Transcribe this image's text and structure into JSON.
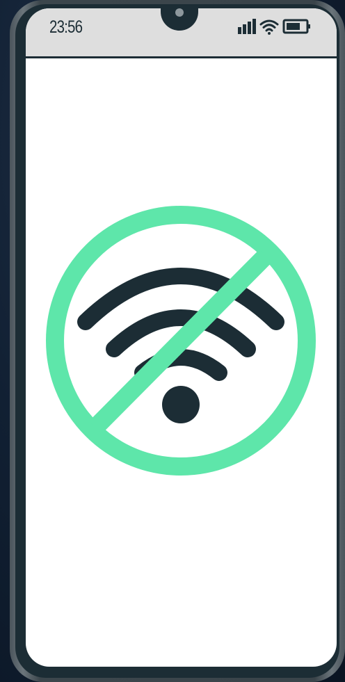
{
  "status_bar": {
    "time": "23:56",
    "icons": [
      "cellular-signal-icon",
      "wifi-icon",
      "battery-icon"
    ]
  },
  "content": {
    "illustration": "no-wifi-icon"
  },
  "colors": {
    "background": "#0d1b2a",
    "phone_frame": "#1c2d35",
    "screen": "#ffffff",
    "status_bar": "#dedede",
    "accent": "#5ee6aa",
    "icon_dark": "#1c2d35"
  }
}
